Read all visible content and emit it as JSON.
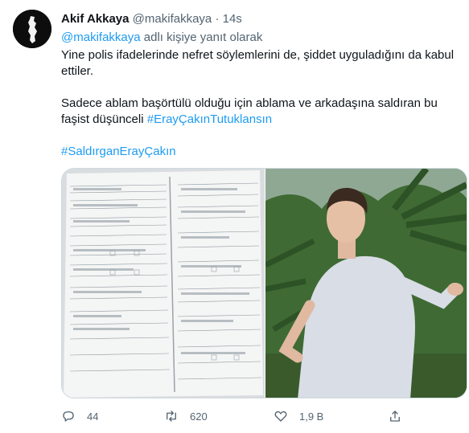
{
  "tweet": {
    "author_name": "Akif Akkaya",
    "handle": "@makifakkaya",
    "separator": "·",
    "time": "14s",
    "reply_mention": "@makifakkaya",
    "reply_suffix": " adlı kişiye yanıt olarak",
    "paragraph1": "Yine polis ifadelerinde nefret söylemlerini de, şiddet uyguladığını da kabul ettiler.",
    "paragraph2_text": "Sadece ablam başörtülü olduğu için ablama ve arkadaşına saldıran bu faşist düşünceli ",
    "paragraph2_hashtag": "#ErayÇakınTutuklansın",
    "paragraph3_hashtag": "#SaldırganErayÇakın"
  },
  "media": {
    "left_image": "police-statement-document-photo",
    "right_image": "man-in-white-tshirt-gesturing-photo"
  },
  "actions": {
    "reply_count": "44",
    "retweet_count": "620",
    "like_count": "1,9 B"
  },
  "colors": {
    "link": "#1d9bf0",
    "secondary_text": "#536471",
    "primary_text": "#0f1419",
    "border": "#cfd9de"
  },
  "icons": [
    "reply-icon",
    "retweet-icon",
    "like-icon",
    "share-icon"
  ]
}
